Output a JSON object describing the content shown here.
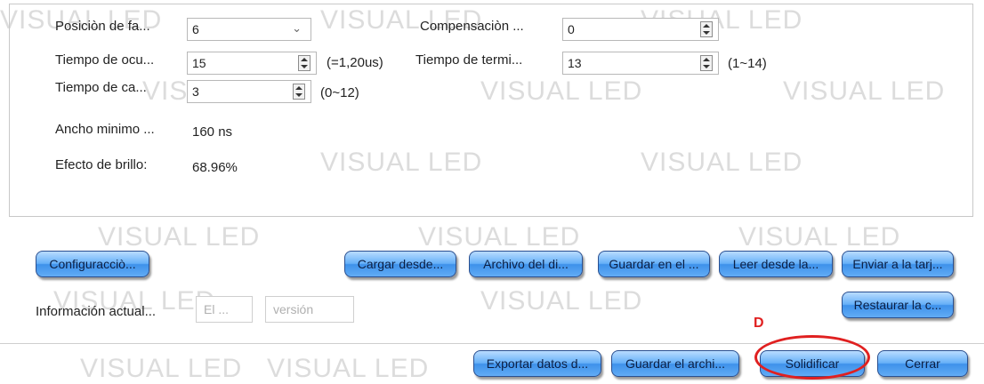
{
  "watermark": "VISUAL LED",
  "settings": {
    "posicion_fase": {
      "label": "Posiciòn de fa...",
      "value": "6"
    },
    "compensacion": {
      "label": "Compensaciòn ...",
      "value": "0"
    },
    "tiempo_ocu": {
      "label": "Tiempo de ocu...",
      "value": "15",
      "hint": "(=1,20us)"
    },
    "tiempo_termi": {
      "label": "Tiempo de termi...",
      "value": "13",
      "hint": "(1~14)"
    },
    "tiempo_ca": {
      "label": "Tiempo de ca...",
      "value": "3",
      "hint": "(0~12)"
    },
    "ancho_minimo": {
      "label": "Ancho minimo ...",
      "value": "160 ns"
    },
    "efecto_brillo": {
      "label": "Efecto de brillo:",
      "value": "68.96%"
    }
  },
  "buttons": {
    "configuracion": "Configuracciò...",
    "cargar_desde": "Cargar desde...",
    "archivo_del_di": "Archivo del di...",
    "guardar_en_el": "Guardar en el ...",
    "leer_desde_la": "Leer desde la...",
    "enviar_a_la_tarj": "Enviar a la tarj...",
    "restaurar": "Restaurar la c...",
    "exportar_datos": "Exportar datos d...",
    "guardar_el_archi": "Guardar el archi...",
    "solidificar": "Solidificar",
    "cerrar": "Cerrar"
  },
  "info": {
    "label": "Información actual...",
    "field1": "El ...",
    "field2": "versión"
  },
  "annotation": {
    "letter": "D",
    "color": "#e02020"
  }
}
